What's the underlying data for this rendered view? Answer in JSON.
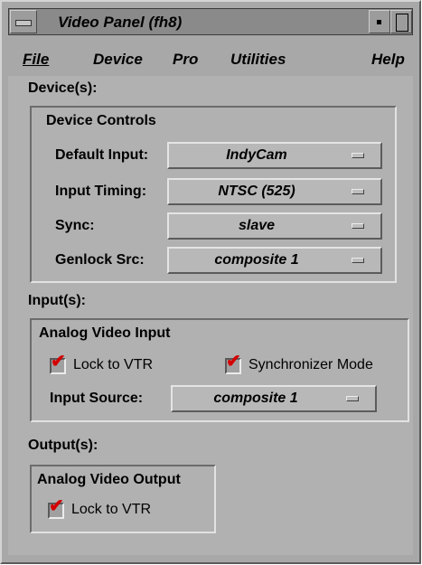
{
  "window": {
    "title": "Video Panel (fh8)"
  },
  "menubar": {
    "items": [
      "File",
      "Device",
      "Pro",
      "Utilities",
      "Help"
    ]
  },
  "devices": {
    "section_label": "Device(s):",
    "group_title": "Device Controls",
    "rows": [
      {
        "label": "Default Input:",
        "value": "IndyCam"
      },
      {
        "label": "Input Timing:",
        "value": "NTSC (525)"
      },
      {
        "label": "Sync:",
        "value": "slave"
      },
      {
        "label": "Genlock Src:",
        "value": "composite 1"
      }
    ]
  },
  "inputs": {
    "section_label": "Input(s):",
    "group_title": "Analog Video Input",
    "lock_to_vtr": {
      "label": "Lock to VTR",
      "checked": true
    },
    "synchronizer_mode": {
      "label": "Synchronizer Mode",
      "checked": true
    },
    "input_source": {
      "label": "Input Source:",
      "value": "composite 1"
    }
  },
  "outputs": {
    "section_label": "Output(s):",
    "group_title": "Analog Video Output",
    "lock_to_vtr": {
      "label": "Lock to VTR",
      "checked": true
    }
  },
  "colors": {
    "panel_bg": "#b1b1b1",
    "check_color": "#d40000"
  }
}
